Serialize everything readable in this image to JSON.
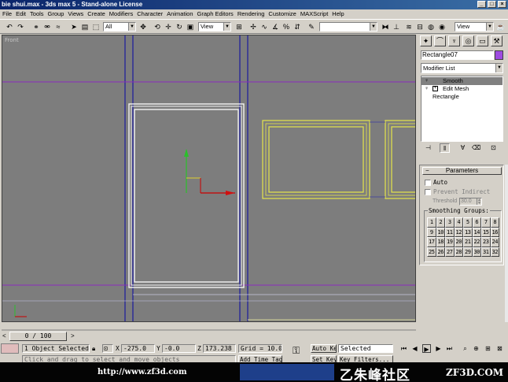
{
  "window": {
    "title": "bie shui.max - 3ds max 5 - Stand-alone License",
    "controls": [
      "_",
      "□",
      "×"
    ]
  },
  "menu": [
    "File",
    "Edit",
    "Tools",
    "Group",
    "Views",
    "Create",
    "Modifiers",
    "Character",
    "Animation",
    "Graph Editors",
    "Rendering",
    "Customize",
    "MAXScript",
    "Help"
  ],
  "toolbar": {
    "selection_filter": "All",
    "ref_coord": "View",
    "named_selection": "",
    "view_right": "View"
  },
  "viewport": {
    "label": "Front",
    "axis_y": "y",
    "axis_x": "x"
  },
  "command_panel": {
    "object_name": "Rectangle07",
    "object_color": "#9e4be0",
    "modifier_list": "Modifier List",
    "stack": [
      {
        "label": "Smooth",
        "selected": true
      },
      {
        "label": "Edit Mesh",
        "selected": false
      },
      {
        "label": "Rectangle",
        "selected": false
      }
    ],
    "rollout": {
      "title": "Parameters",
      "auto_label": "Auto",
      "prevent_label": "Prevent Indirect",
      "threshold_label": "Threshold",
      "threshold_value": "30.0",
      "groups_title": "Smoothing Groups:",
      "groups": [
        "1",
        "2",
        "3",
        "4",
        "5",
        "6",
        "7",
        "8",
        "9",
        "10",
        "11",
        "12",
        "13",
        "14",
        "15",
        "16",
        "17",
        "18",
        "19",
        "20",
        "21",
        "22",
        "23",
        "24",
        "25",
        "26",
        "27",
        "28",
        "29",
        "30",
        "31",
        "32"
      ]
    }
  },
  "timeline": {
    "position": "0 / 100"
  },
  "status": {
    "selection": "1 Object Selected",
    "prompt": "Click and drag to select and move objects",
    "x_label": "X",
    "x_value": "-275.0",
    "y_label": "Y",
    "y_value": "-0.0",
    "z_label": "Z",
    "z_value": "173.238",
    "grid": "Grid = 10.0",
    "add_time_tag": "Add Time Tag",
    "auto_key": "Auto Key",
    "set_key": "Set Key",
    "key_mode": "Selected",
    "key_filters": "Key Filters..."
  },
  "watermark": {
    "url": "http://www.zf3d.com",
    "cn": "乙朱峰社区",
    "en": "ZF3D.COM"
  }
}
